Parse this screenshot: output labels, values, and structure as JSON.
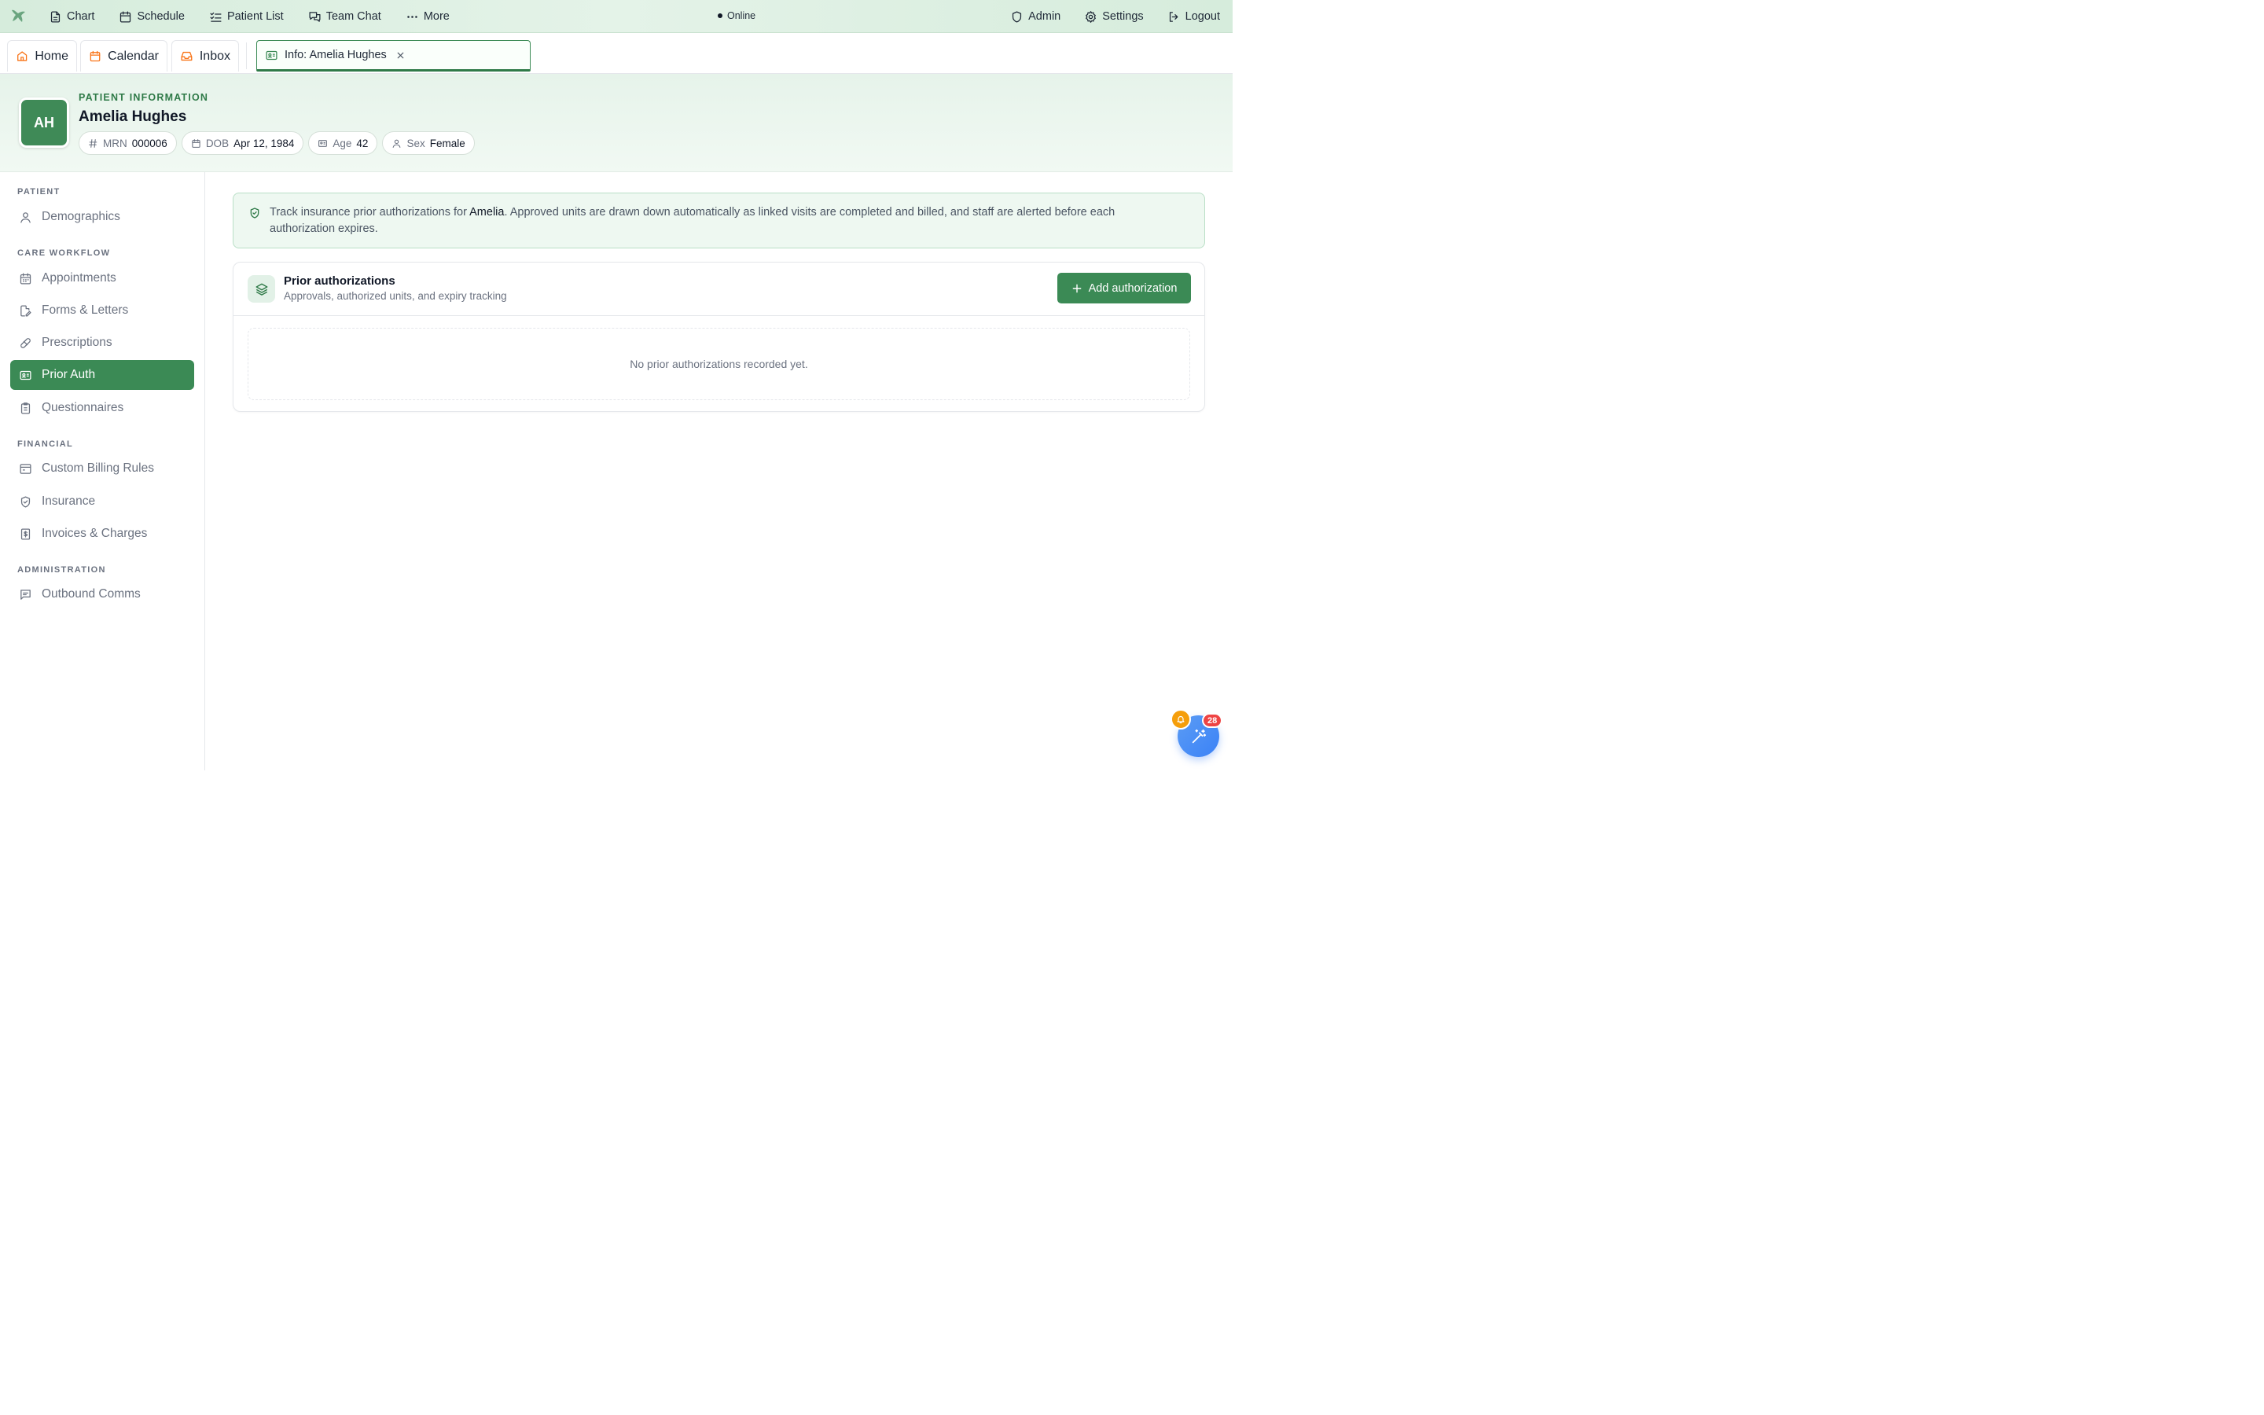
{
  "topbar": {
    "nav_left": [
      {
        "label": "Chart",
        "icon": "file-text-icon"
      },
      {
        "label": "Schedule",
        "icon": "calendar-icon"
      },
      {
        "label": "Patient List",
        "icon": "list-checks-icon"
      },
      {
        "label": "Team Chat",
        "icon": "messages-icon"
      },
      {
        "label": "More",
        "icon": "more-dots-icon"
      }
    ],
    "status": "Online",
    "nav_right": [
      {
        "label": "Admin",
        "icon": "shield-icon"
      },
      {
        "label": "Settings",
        "icon": "gear-icon"
      },
      {
        "label": "Logout",
        "icon": "logout-icon"
      }
    ]
  },
  "tabs": {
    "items": [
      {
        "label": "Home",
        "icon": "home-icon"
      },
      {
        "label": "Calendar",
        "icon": "calendar-icon"
      },
      {
        "label": "Inbox",
        "icon": "inbox-icon"
      }
    ],
    "active": {
      "label": "Info: Amelia Hughes",
      "icon": "id-card-icon"
    }
  },
  "patient": {
    "section_label": "PATIENT INFORMATION",
    "initials": "AH",
    "name": "Amelia Hughes",
    "chips": [
      {
        "key": "MRN",
        "value": "000006",
        "icon": "hash-icon"
      },
      {
        "key": "DOB",
        "value": "Apr 12, 1984",
        "icon": "calendar-icon"
      },
      {
        "key": "Age",
        "value": "42",
        "icon": "id-card-icon"
      },
      {
        "key": "Sex",
        "value": "Female",
        "icon": "user-icon"
      }
    ]
  },
  "sidebar": {
    "sections": [
      {
        "title": "PATIENT",
        "items": [
          {
            "label": "Demographics",
            "icon": "user-icon"
          }
        ]
      },
      {
        "title": "CARE WORKFLOW",
        "items": [
          {
            "label": "Appointments",
            "icon": "calendar-icon"
          },
          {
            "label": "Forms & Letters",
            "icon": "file-edit-icon"
          },
          {
            "label": "Prescriptions",
            "icon": "pill-icon"
          },
          {
            "label": "Prior Auth",
            "icon": "id-card-icon",
            "active": true
          },
          {
            "label": "Questionnaires",
            "icon": "clipboard-icon"
          }
        ]
      },
      {
        "title": "FINANCIAL",
        "items": [
          {
            "label": "Custom Billing Rules",
            "icon": "billing-icon"
          },
          {
            "label": "Insurance",
            "icon": "shield-check-icon"
          },
          {
            "label": "Invoices & Charges",
            "icon": "receipt-icon"
          }
        ]
      },
      {
        "title": "ADMINISTRATION",
        "items": [
          {
            "label": "Outbound Comms",
            "icon": "message-square-icon"
          }
        ]
      }
    ]
  },
  "info_banner": {
    "prefix": "Track insurance prior authorizations for ",
    "patient_first": "Amelia",
    "suffix": ". Approved units are drawn down automatically as linked visits are completed and billed, and staff are alerted before each authorization expires."
  },
  "card": {
    "title": "Prior authorizations",
    "subtitle": "Approvals, authorized units, and expiry tracking",
    "add_button": "Add authorization",
    "empty_text": "No prior authorizations recorded yet."
  },
  "fab": {
    "badge": "28"
  },
  "colors": {
    "primary": "#3b8a55",
    "accent_orange": "#f97316",
    "fab_blue": "#3b82f6",
    "badge_red": "#ef4444"
  }
}
